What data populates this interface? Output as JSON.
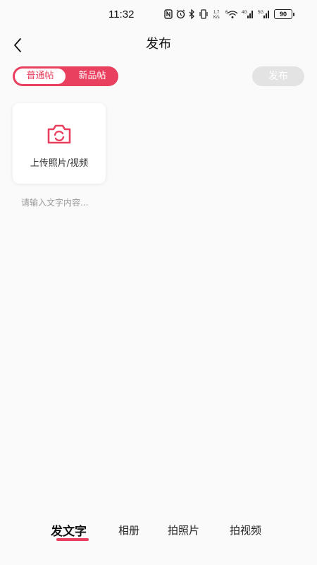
{
  "status_bar": {
    "time": "11:32",
    "network_speed": "1.7\nK/s",
    "battery": "90"
  },
  "header": {
    "title": "发布",
    "back_icon": "chevron-left-icon"
  },
  "segment": {
    "active_label": "普通帖",
    "inactive_label": "新品帖"
  },
  "publish_button": {
    "label": "发布"
  },
  "upload": {
    "icon": "camera-icon",
    "label": "上传照片/视频"
  },
  "text_input": {
    "placeholder": "请输入文字内容..."
  },
  "bottom_tabs": [
    {
      "label": "发文字",
      "active": true
    },
    {
      "label": "相册",
      "active": false
    },
    {
      "label": "拍照片",
      "active": false
    },
    {
      "label": "拍视频",
      "active": false
    }
  ],
  "colors": {
    "accent": "#e8405e",
    "disabled_button": "#e3e3e3",
    "background": "#fafafa"
  }
}
